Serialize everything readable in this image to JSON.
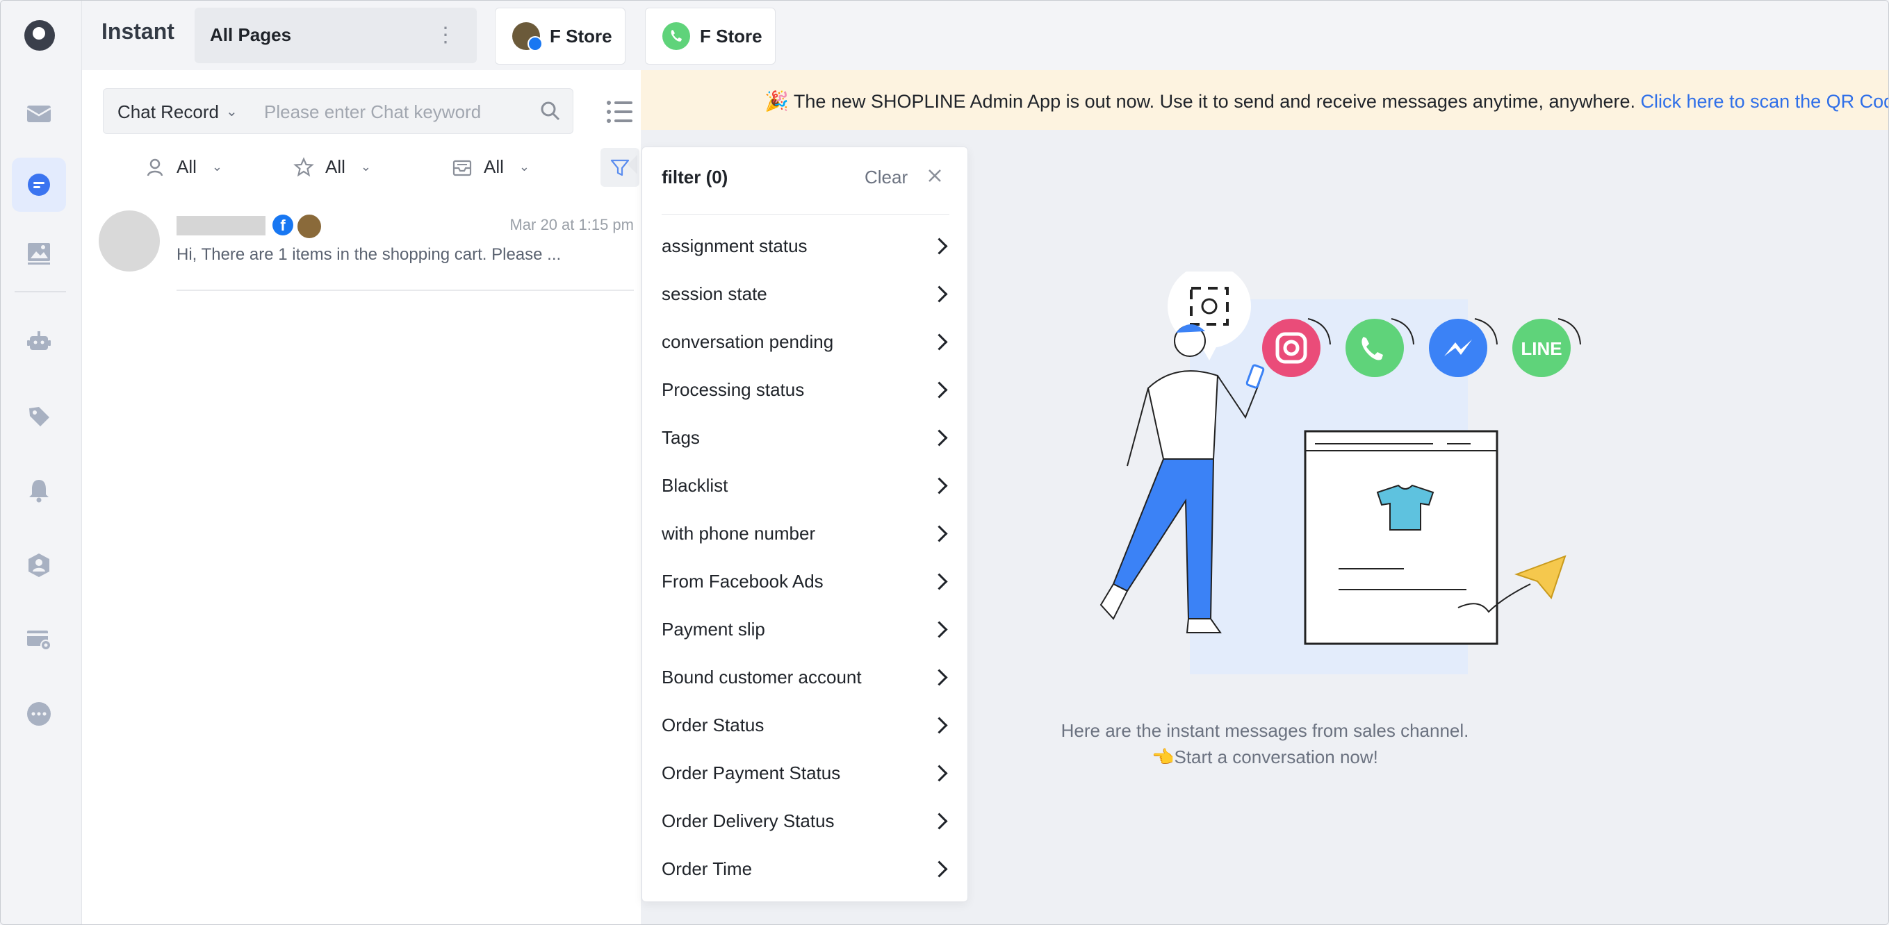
{
  "app": {
    "title": "Instant"
  },
  "header": {
    "page_select": "All Pages",
    "stores": [
      {
        "label": "F Store",
        "icon": "facebook-store-avatar"
      },
      {
        "label": "F Store",
        "icon": "whatsapp-icon"
      }
    ]
  },
  "sidebar": {
    "items": [
      {
        "name": "inbox",
        "icon": "mail-icon"
      },
      {
        "name": "chat",
        "icon": "chat-icon",
        "active": true
      },
      {
        "name": "media",
        "icon": "image-icon"
      },
      {
        "name": "bot",
        "icon": "robot-icon"
      },
      {
        "name": "tags",
        "icon": "tag-icon"
      },
      {
        "name": "notifications",
        "icon": "bell-icon"
      },
      {
        "name": "contacts",
        "icon": "user-shield-icon"
      },
      {
        "name": "settings",
        "icon": "card-settings-icon"
      },
      {
        "name": "more",
        "icon": "more-icon"
      }
    ]
  },
  "search": {
    "record_type": "Chat Record",
    "placeholder": "Please enter Chat keyword"
  },
  "filters": {
    "assignee": "All",
    "star": "All",
    "inbox": "All"
  },
  "chats": [
    {
      "time": "Mar 20 at 1:15 pm",
      "preview": "Hi, There are 1 items in the shopping cart. Please ..."
    }
  ],
  "banner": {
    "text": "The new SHOPLINE Admin App is out now. Use it to send and receive messages anytime, anywhere.",
    "link": "Click here to scan the QR Code"
  },
  "filter_panel": {
    "title": "filter (0)",
    "clear": "Clear",
    "items": [
      "assignment status",
      "session state",
      "conversation pending",
      "Processing status",
      "Tags",
      "Blacklist",
      "with phone number",
      "From Facebook Ads",
      "Payment slip",
      "Bound customer account",
      "Order Status",
      "Order Payment Status",
      "Order Delivery Status",
      "Order Time"
    ]
  },
  "empty_state": {
    "line1": "Here are the instant messages from sales channel.",
    "line2": "Start a conversation now!",
    "channel_icons": [
      "instagram-icon",
      "whatsapp-icon",
      "messenger-icon"
    ],
    "line_badge": "LINE"
  },
  "colors": {
    "accent": "#2f6fe8",
    "banner_bg": "#fdf3e0",
    "arrow": "#e94735",
    "instagram": "#ea4c79",
    "whatsapp": "#5fd37a",
    "messenger": "#3b82f6",
    "line": "#5fd37a"
  }
}
